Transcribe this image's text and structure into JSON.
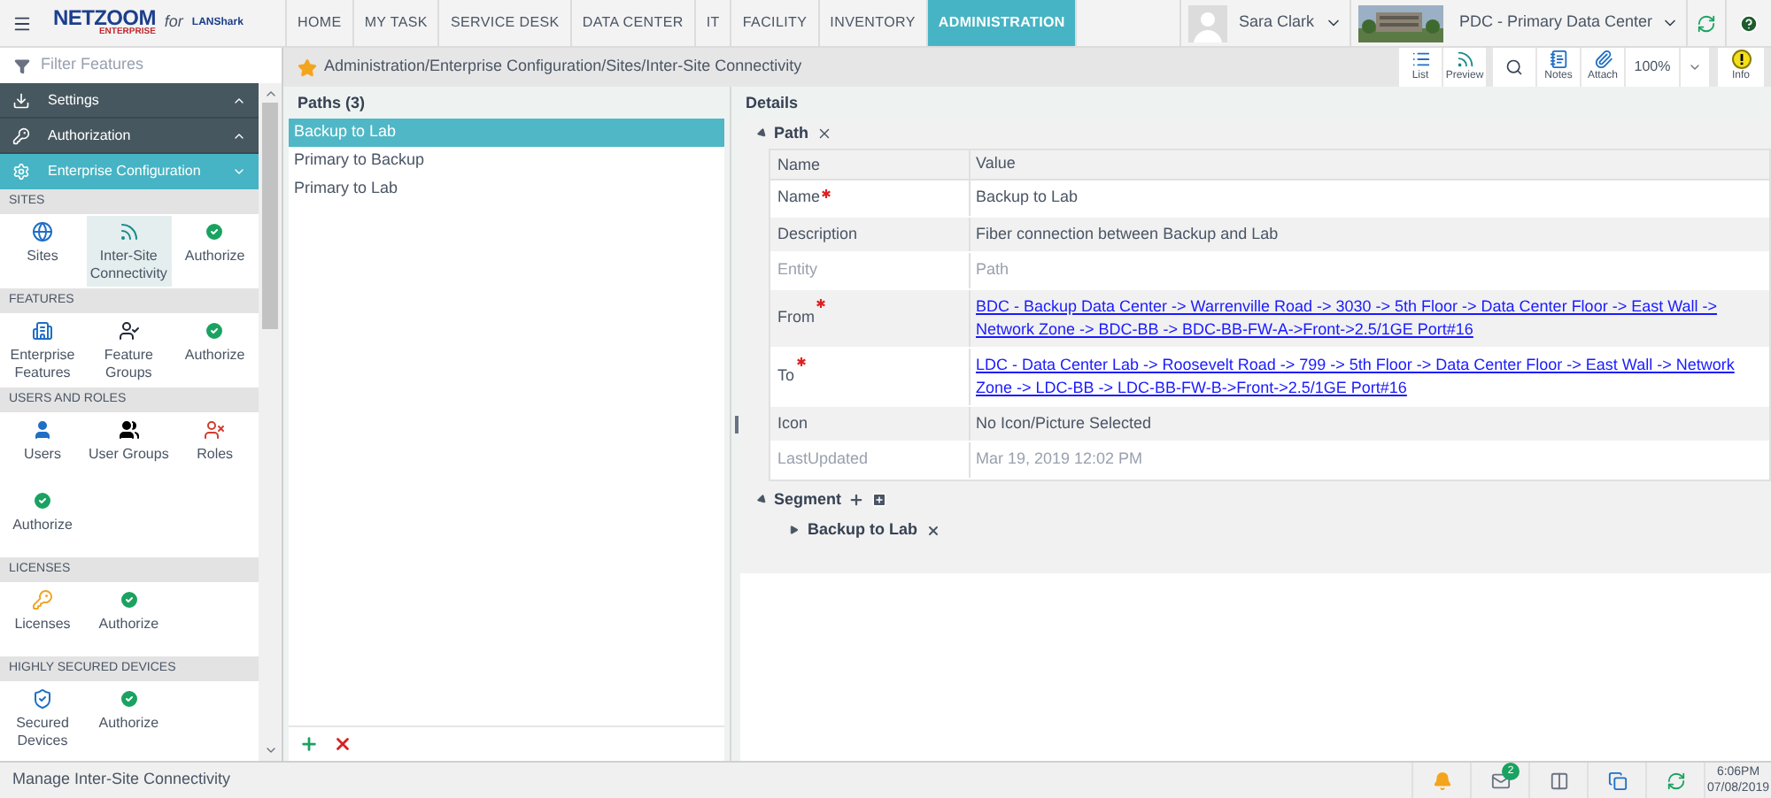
{
  "header": {
    "logo": {
      "name": "NETZOOM",
      "sub": "ENTERPRISE",
      "joiner": "for",
      "partner": "LANShark"
    },
    "nav_tabs": [
      {
        "label": "HOME",
        "selected": false
      },
      {
        "label": "MY TASK",
        "selected": false
      },
      {
        "label": "SERVICE DESK",
        "selected": false
      },
      {
        "label": "DATA CENTER",
        "selected": false
      },
      {
        "label": "IT",
        "selected": false
      },
      {
        "label": "FACILITY",
        "selected": false
      },
      {
        "label": "INVENTORY",
        "selected": false
      },
      {
        "label": "ADMINISTRATION",
        "selected": true
      }
    ],
    "user": {
      "name": "Sara Clark"
    },
    "site": {
      "name": "PDC - Primary Data Center"
    }
  },
  "filter": {
    "placeholder": "Filter Features"
  },
  "sidebar": {
    "menus": [
      {
        "label": "Settings",
        "kind": "settings",
        "expanded": false
      },
      {
        "label": "Authorization",
        "kind": "key",
        "expanded": false
      },
      {
        "label": "Enterprise Configuration",
        "kind": "gear",
        "expanded": true
      }
    ],
    "sections": [
      {
        "title": "SITES",
        "items": [
          {
            "label": "Sites",
            "kind": "globe",
            "selected": false
          },
          {
            "label": "Inter-Site Connectivity",
            "kind": "link",
            "selected": true
          },
          {
            "label": "Authorize",
            "kind": "check",
            "selected": false
          }
        ]
      },
      {
        "title": "FEATURES",
        "items": [
          {
            "label": "Enterprise Features",
            "kind": "building",
            "selected": false
          },
          {
            "label": "Feature Groups",
            "kind": "group",
            "selected": false
          },
          {
            "label": "Authorize",
            "kind": "check",
            "selected": false
          }
        ]
      },
      {
        "title": "USERS AND ROLES",
        "items": [
          {
            "label": "Users",
            "kind": "user",
            "selected": false
          },
          {
            "label": "User Groups",
            "kind": "users",
            "selected": false
          },
          {
            "label": "Roles",
            "kind": "roles",
            "selected": false
          },
          {
            "label": "Authorize",
            "kind": "check",
            "selected": false
          }
        ]
      },
      {
        "title": "LICENSES",
        "items": [
          {
            "label": "Licenses",
            "kind": "key",
            "selected": false
          },
          {
            "label": "Authorize",
            "kind": "check",
            "selected": false
          }
        ]
      },
      {
        "title": "HIGHLY SECURED DEVICES",
        "items": [
          {
            "label": "Secured Devices",
            "kind": "shield",
            "selected": false
          },
          {
            "label": "Authorize",
            "kind": "check",
            "selected": false
          }
        ]
      }
    ]
  },
  "breadcrumb": "Administration/Enterprise Configuration/Sites/Inter-Site Connectivity",
  "toolbar": [
    {
      "label": "List",
      "kind": "list"
    },
    {
      "label": "Preview",
      "kind": "preview"
    },
    {
      "kind": "search"
    },
    {
      "label": "Notes",
      "kind": "notes"
    },
    {
      "label": "Attach",
      "kind": "attach"
    },
    {
      "label": "100%",
      "kind": "zoom"
    },
    {
      "kind": "dropdown"
    },
    {
      "label": "Info",
      "kind": "info"
    }
  ],
  "paths": {
    "title": "Paths (3)",
    "items": [
      {
        "label": "Backup to Lab",
        "selected": true
      },
      {
        "label": "Primary to Backup",
        "selected": false
      },
      {
        "label": "Primary to Lab",
        "selected": false
      }
    ]
  },
  "details": {
    "title": "Details",
    "path_group": {
      "title": "Path",
      "expanded": true,
      "columns": [
        "Name",
        "Value"
      ],
      "rows": [
        {
          "name": "Name",
          "required": true,
          "kind": "text",
          "value": "Backup to Lab"
        },
        {
          "name": "Description",
          "required": false,
          "kind": "text",
          "value": "Fiber connection between Backup and Lab"
        },
        {
          "name": "Entity",
          "required": false,
          "kind": "muted",
          "value": "Path"
        },
        {
          "name": "From",
          "required": true,
          "kind": "link",
          "value": "BDC - Backup Data Center -> Warrenville Road -> 3030 -> 5th Floor -> Data Center Floor -> East Wall -> Network Zone -> BDC-BB -> BDC-BB-FW-A->Front->2.5/1GE Port#16"
        },
        {
          "name": "To",
          "required": true,
          "kind": "link",
          "value": "LDC - Data Center Lab -> Roosevelt Road -> 799 -> 5th Floor -> Data Center Floor -> East Wall -> Network Zone -> LDC-BB -> LDC-BB-FW-B->Front->2.5/1GE Port#16"
        },
        {
          "name": "Icon",
          "required": false,
          "kind": "text",
          "value": "No Icon/Picture Selected"
        },
        {
          "name": "LastUpdated",
          "required": false,
          "kind": "muted",
          "value": "Mar 19, 2019 12:02 PM"
        }
      ]
    },
    "segment_group": {
      "title": "Segment",
      "expanded": true,
      "items": [
        {
          "label": "Backup to Lab",
          "expanded": false
        }
      ]
    }
  },
  "status_bar": {
    "message": "Manage Inter-Site Connectivity",
    "mail_count": "2",
    "time": "6:06PM",
    "date": "07/08/2019"
  }
}
